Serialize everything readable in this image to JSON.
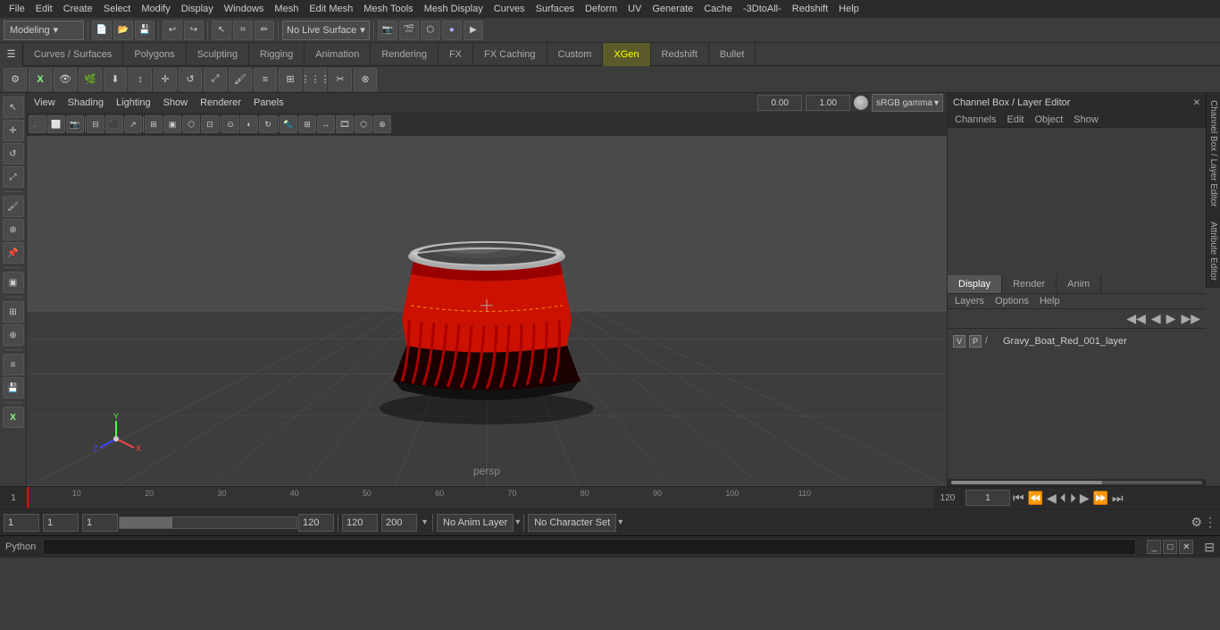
{
  "menubar": {
    "items": [
      "File",
      "Edit",
      "Create",
      "Select",
      "Modify",
      "Display",
      "Windows",
      "Mesh",
      "Edit Mesh",
      "Mesh Tools",
      "Mesh Display",
      "Curves",
      "Surfaces",
      "Deform",
      "UV",
      "Generate",
      "Cache",
      "-3DtoAll-",
      "Redshift",
      "Help"
    ]
  },
  "toolbar": {
    "mode": "Modeling",
    "no_live_surface": "No Live Surface"
  },
  "tabs": {
    "items": [
      "Curves / Surfaces",
      "Polygons",
      "Sculpting",
      "Rigging",
      "Animation",
      "Rendering",
      "FX",
      "FX Caching",
      "Custom",
      "XGen",
      "Redshift",
      "Bullet"
    ]
  },
  "viewport": {
    "menus": [
      "View",
      "Shading",
      "Lighting",
      "Show",
      "Renderer",
      "Panels"
    ],
    "persp_label": "persp",
    "color_value1": "0.00",
    "color_value2": "1.00",
    "color_mode": "sRGB gamma"
  },
  "channel_box": {
    "title": "Channel Box / Layer Editor",
    "sub_menus": [
      "Channels",
      "Edit",
      "Object",
      "Show"
    ]
  },
  "display_tabs": {
    "items": [
      "Display",
      "Render",
      "Anim"
    ],
    "active": "Display"
  },
  "display_options": {
    "items": [
      "Layers",
      "Options",
      "Help"
    ]
  },
  "layers": {
    "items": [
      {
        "v": "V",
        "p": "P",
        "color": "#888888",
        "name": "Gravy_Boat_Red_001_layer"
      }
    ]
  },
  "bottom_bar": {
    "field1": "1",
    "field2": "1",
    "field3": "1",
    "field4": "120",
    "field5": "120",
    "field6": "200",
    "no_anim_layer": "No Anim Layer",
    "no_char_set": "No Character Set"
  },
  "python_bar": {
    "label": "Python"
  },
  "icons": {
    "close": "✕",
    "arrow_left": "◀",
    "arrow_right": "▶",
    "arrow_up": "▲",
    "arrow_down": "▼",
    "double_arrow_left": "◀◀",
    "double_arrow_right": "▶▶",
    "key": "⬦",
    "layer_add": "⊕",
    "move": "↔",
    "eye": "👁"
  }
}
